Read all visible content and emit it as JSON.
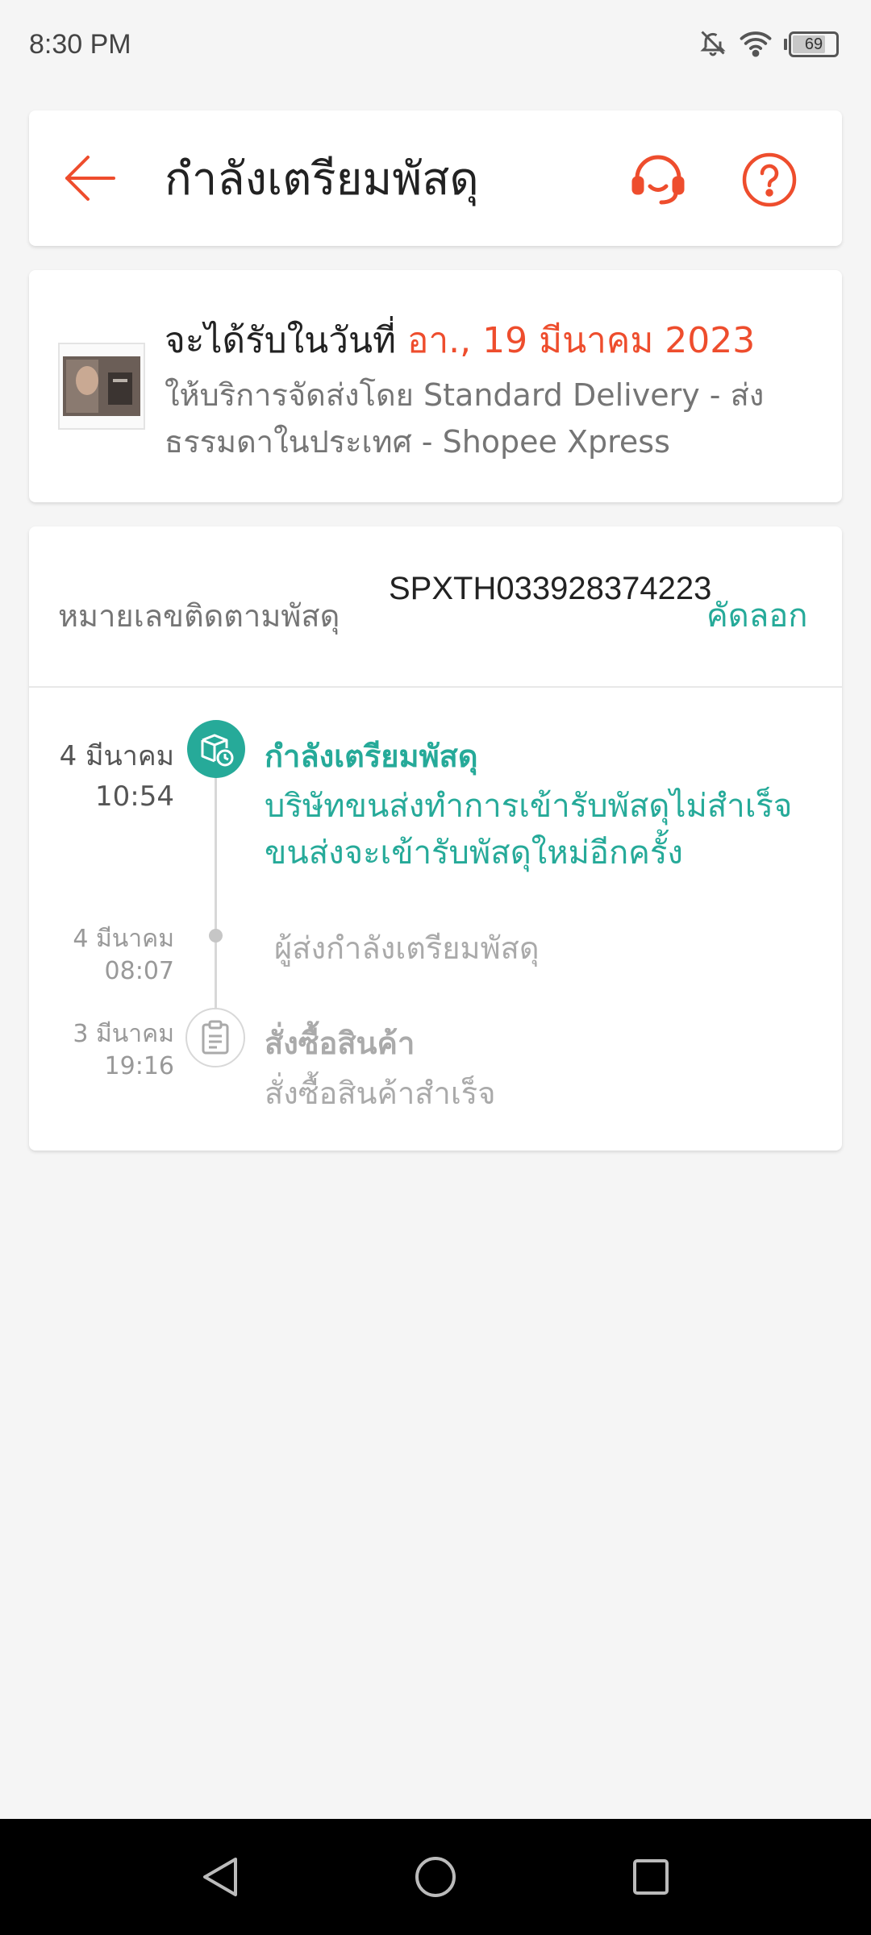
{
  "status_bar": {
    "time": "8:30 PM",
    "battery": "69",
    "icons": [
      "bell-off-icon",
      "wifi-icon",
      "battery-icon"
    ]
  },
  "header": {
    "title": "กำลังเตรียมพัสดุ",
    "icons": [
      "back-arrow-icon",
      "headset-icon",
      "help-icon"
    ],
    "accent_color": "#ee4d2d"
  },
  "delivery": {
    "prefix": "จะได้รับในวันที่ ",
    "date": "อา., 19 มีนาคม 2023",
    "description": "ให้บริการจัดส่งโดย Standard Delivery - ส่งธรรมดาในประเทศ - Shopee Xpress"
  },
  "tracking": {
    "label": "หมายเลขติดตามพัสดุ",
    "number": "SPXTH033928374223",
    "copy_label": "คัดลอก"
  },
  "timeline": [
    {
      "date": "4 มีนาคม",
      "time": "10:54",
      "title": "กำลังเตรียมพัสดุ",
      "description": "บริษัทขนส่งทำการเข้ารับพัสดุไม่สำเร็จ ขนส่งจะเข้ารับพัสดุใหม่อีกครั้ง",
      "icon": "parcel-clock-icon",
      "active": true
    },
    {
      "date": "4 มีนาคม",
      "time": "08:07",
      "description": "ผู้ส่งกำลังเตรียมพัสดุ",
      "active": false
    },
    {
      "date": "3 มีนาคม",
      "time": "19:16",
      "title": "สั่งซื้อสินค้า",
      "description": "สั่งซื้อสินค้าสำเร็จ",
      "icon": "clipboard-icon",
      "active": false
    }
  ],
  "colors": {
    "primary": "#ee4d2d",
    "teal": "#26aa99",
    "muted": "#aaaaaa"
  },
  "nav": [
    "back-triangle-icon",
    "home-circle-icon",
    "recents-square-icon"
  ]
}
